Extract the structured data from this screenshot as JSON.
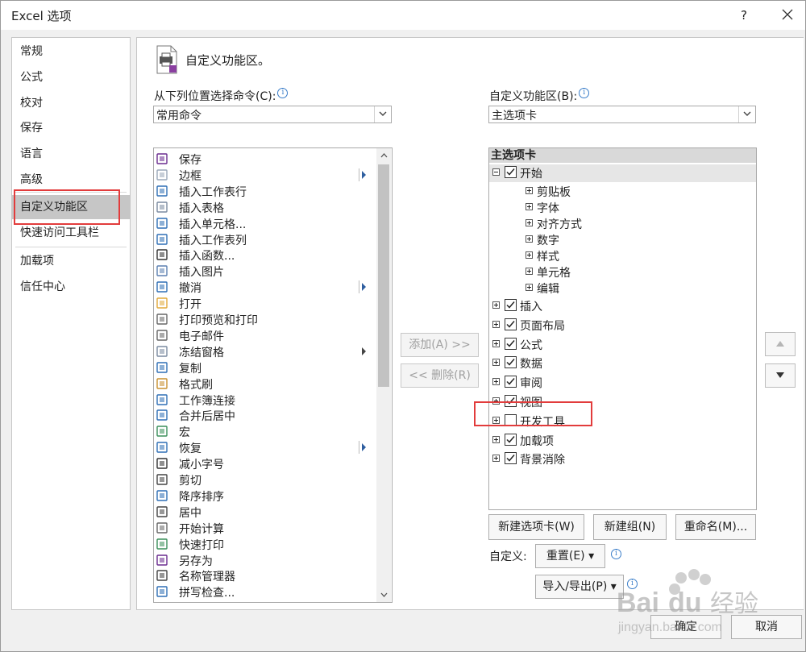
{
  "window": {
    "title": "Excel 选项",
    "help": "?"
  },
  "sidebar": {
    "items": [
      {
        "label": "常规"
      },
      {
        "label": "公式"
      },
      {
        "label": "校对"
      },
      {
        "label": "保存"
      },
      {
        "label": "语言"
      },
      {
        "label": "高级"
      },
      {
        "label": "自定义功能区",
        "selected": true
      },
      {
        "label": "快速访问工具栏"
      },
      {
        "label": "加载项"
      },
      {
        "label": "信任中心"
      }
    ]
  },
  "header": {
    "title": "自定义功能区。"
  },
  "left": {
    "label": "从下列位置选择命令(C):",
    "info": "i",
    "combo_value": "常用命令",
    "commands": [
      {
        "label": "保存",
        "icon": "save-icon"
      },
      {
        "label": "边框",
        "icon": "border-icon",
        "submenu": "split"
      },
      {
        "label": "插入工作表行",
        "icon": "insert-rows-icon"
      },
      {
        "label": "插入表格",
        "icon": "insert-table-icon"
      },
      {
        "label": "插入单元格...",
        "icon": "insert-cells-icon"
      },
      {
        "label": "插入工作表列",
        "icon": "insert-columns-icon"
      },
      {
        "label": "插入函数...",
        "icon": "function-icon"
      },
      {
        "label": "插入图片",
        "icon": "picture-icon"
      },
      {
        "label": "撤消",
        "icon": "undo-icon",
        "submenu": "split"
      },
      {
        "label": "打开",
        "icon": "open-folder-icon"
      },
      {
        "label": "打印预览和打印",
        "icon": "print-preview-icon"
      },
      {
        "label": "电子邮件",
        "icon": "email-icon"
      },
      {
        "label": "冻结窗格",
        "icon": "freeze-panes-icon",
        "submenu": "arrow"
      },
      {
        "label": "复制",
        "icon": "copy-icon"
      },
      {
        "label": "格式刷",
        "icon": "format-painter-icon"
      },
      {
        "label": "工作簿连接",
        "icon": "connections-icon"
      },
      {
        "label": "合并后居中",
        "icon": "merge-center-icon"
      },
      {
        "label": "宏",
        "icon": "macro-icon"
      },
      {
        "label": "恢复",
        "icon": "redo-icon",
        "submenu": "split"
      },
      {
        "label": "减小字号",
        "icon": "decrease-font-icon"
      },
      {
        "label": "剪切",
        "icon": "cut-icon"
      },
      {
        "label": "降序排序",
        "icon": "sort-desc-icon"
      },
      {
        "label": "居中",
        "icon": "align-center-icon"
      },
      {
        "label": "开始计算",
        "icon": "calculator-icon"
      },
      {
        "label": "快速打印",
        "icon": "quick-print-icon"
      },
      {
        "label": "另存为",
        "icon": "save-as-icon"
      },
      {
        "label": "名称管理器",
        "icon": "name-manager-icon"
      },
      {
        "label": "拼写检查...",
        "icon": "spelling-icon"
      }
    ]
  },
  "middle": {
    "add_label": "添加(A) >>",
    "remove_label": "<< 删除(R)"
  },
  "right": {
    "label": "自定义功能区(B):",
    "info": "i",
    "combo_value": "主选项卡",
    "tree_header": "主选项卡",
    "tabs": [
      {
        "label": "开始",
        "checked": true,
        "expanded": true,
        "groups": [
          "剪贴板",
          "字体",
          "对齐方式",
          "数字",
          "样式",
          "单元格",
          "编辑"
        ]
      },
      {
        "label": "插入",
        "checked": true
      },
      {
        "label": "页面布局",
        "checked": true
      },
      {
        "label": "公式",
        "checked": true
      },
      {
        "label": "数据",
        "checked": true
      },
      {
        "label": "审阅",
        "checked": true
      },
      {
        "label": "视图",
        "checked": true
      },
      {
        "label": "开发工具",
        "checked": false,
        "highlighted": true
      },
      {
        "label": "加载项",
        "checked": true
      },
      {
        "label": "背景消除",
        "checked": true
      }
    ],
    "new_tab_label": "新建选项卡(W)",
    "new_group_label": "新建组(N)",
    "rename_label": "重命名(M)...",
    "customize_label": "自定义:",
    "reset_label": "重置(E) ▾",
    "import_export_label": "导入/导出(P) ▾"
  },
  "footer": {
    "ok_label": "确定",
    "cancel_label": "取消"
  },
  "watermark": {
    "brand": "Baidu 经验",
    "url": "jingyan.baidu.com"
  },
  "colors": {
    "highlight_border": "#e23c3c",
    "selected_bg": "#c6c6c6",
    "info_blue": "#3b7ec9"
  }
}
